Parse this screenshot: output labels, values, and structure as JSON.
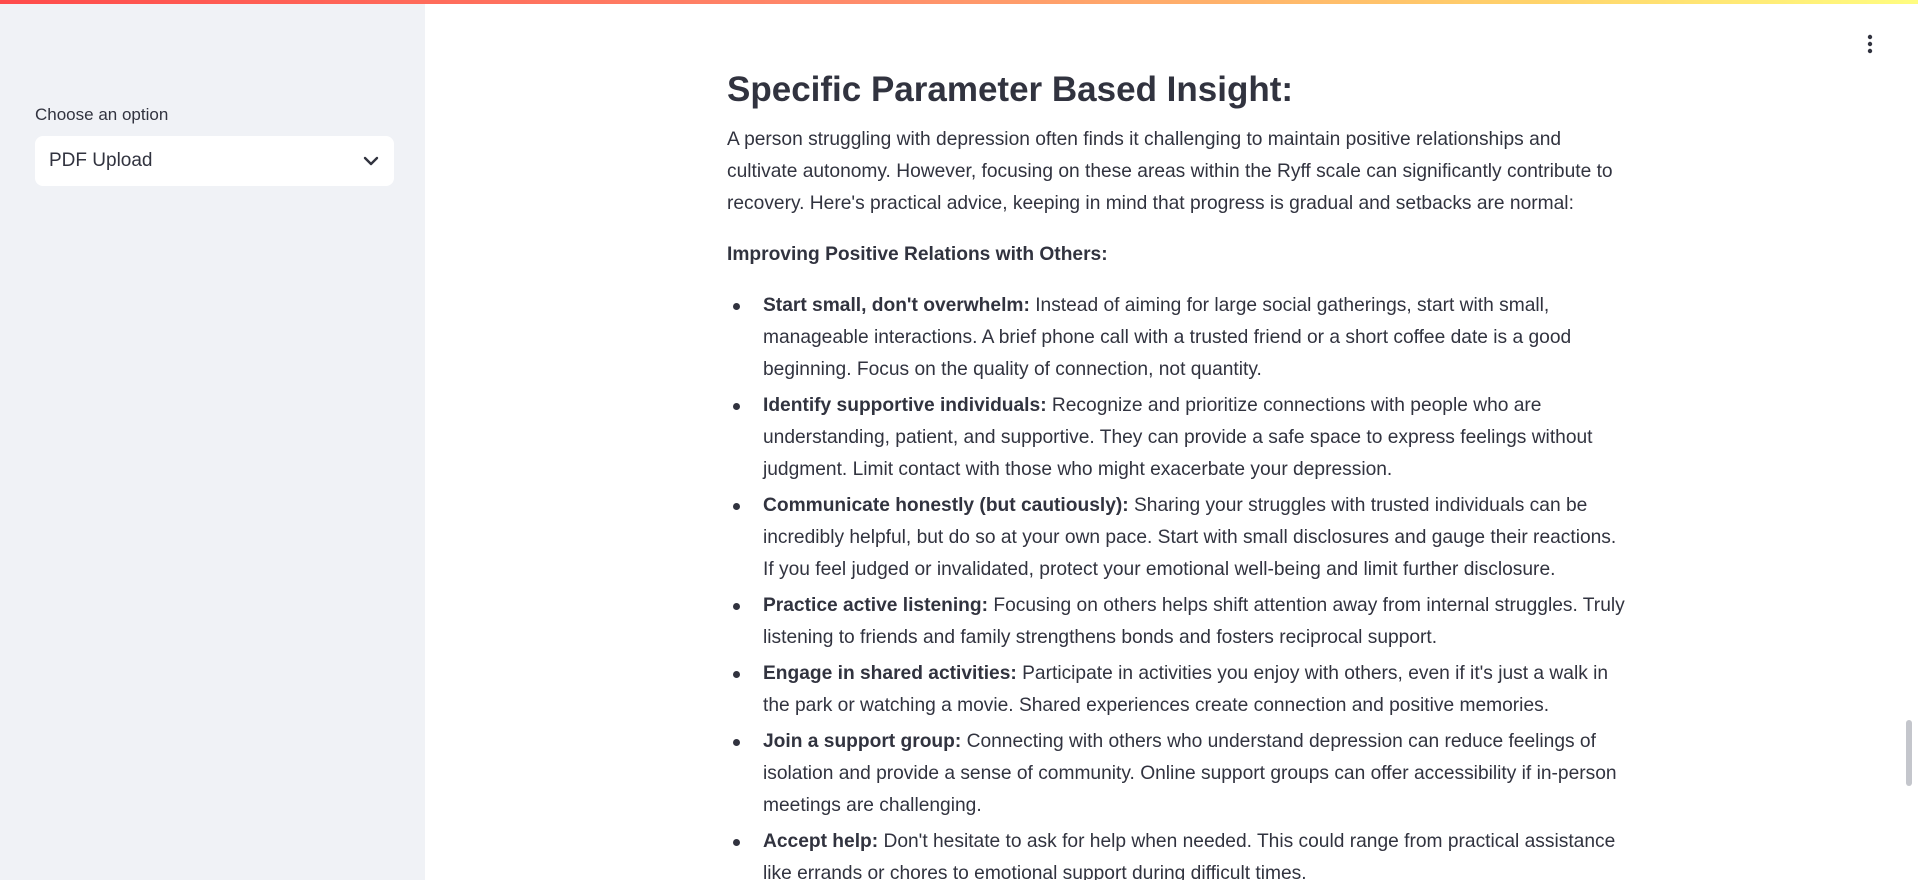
{
  "sidebar": {
    "select_label": "Choose an option",
    "select_value": "PDF Upload"
  },
  "main": {
    "title": "Specific Parameter Based Insight:",
    "intro": "A person struggling with depression often finds it challenging to maintain positive relationships and cultivate autonomy. However, focusing on these areas within the Ryff scale can significantly contribute to recovery. Here's practical advice, keeping in mind that progress is gradual and setbacks are normal:",
    "subheading": "Improving Positive Relations with Others:",
    "tips": [
      {
        "bold": "Start small, don't overwhelm:",
        "text": " Instead of aiming for large social gatherings, start with small, manageable interactions. A brief phone call with a trusted friend or a short coffee date is a good beginning. Focus on the quality of connection, not quantity."
      },
      {
        "bold": "Identify supportive individuals:",
        "text": " Recognize and prioritize connections with people who are understanding, patient, and supportive. They can provide a safe space to express feelings without judgment. Limit contact with those who might exacerbate your depression."
      },
      {
        "bold": "Communicate honestly (but cautiously):",
        "text": " Sharing your struggles with trusted individuals can be incredibly helpful, but do so at your own pace. Start with small disclosures and gauge their reactions. If you feel judged or invalidated, protect your emotional well-being and limit further disclosure."
      },
      {
        "bold": "Practice active listening:",
        "text": " Focusing on others helps shift attention away from internal struggles. Truly listening to friends and family strengthens bonds and fosters reciprocal support."
      },
      {
        "bold": "Engage in shared activities:",
        "text": " Participate in activities you enjoy with others, even if it's just a walk in the park or watching a movie. Shared experiences create connection and positive memories."
      },
      {
        "bold": "Join a support group:",
        "text": " Connecting with others who understand depression can reduce feelings of isolation and provide a sense of community. Online support groups can offer accessibility if in-person meetings are challenging."
      },
      {
        "bold": "Accept help:",
        "text": " Don't hesitate to ask for help when needed. This could range from practical assistance like errands or chores to emotional support during difficult times."
      }
    ]
  },
  "icons": {
    "select_chevron": "chevron-down-icon",
    "main_menu": "kebab-menu-icon"
  },
  "colors": {
    "sidebar_bg": "#f0f2f6",
    "text": "#31333f",
    "accent_gradient_start": "#ff4b4b",
    "accent_gradient_end": "#fffd80"
  }
}
